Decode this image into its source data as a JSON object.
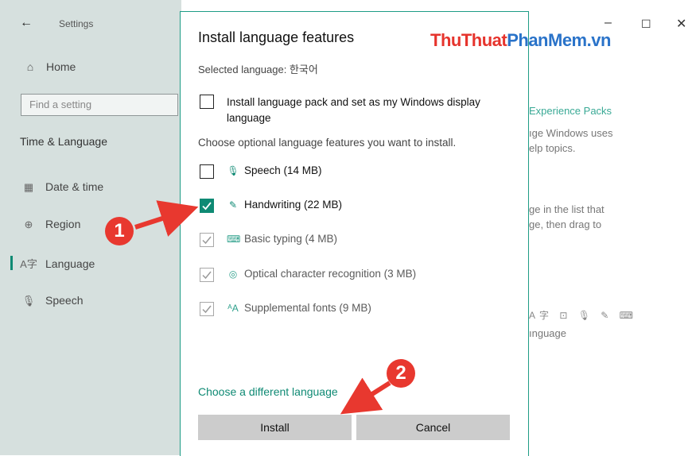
{
  "settings": {
    "back_icon": "back-arrow-icon",
    "title": "Settings",
    "home_label": "Home",
    "search_placeholder": "Find a setting",
    "section_label": "Time & Language",
    "items": [
      {
        "label": "Date & time",
        "icon": "calendar-clock-icon"
      },
      {
        "label": "Region",
        "icon": "globe-icon"
      },
      {
        "label": "Language",
        "icon": "language-icon"
      },
      {
        "label": "Speech",
        "icon": "microphone-icon"
      }
    ],
    "active_item": "Language"
  },
  "background_window": {
    "link": "Experience Packs",
    "lines": [
      "ıge Windows uses",
      "elp topics.",
      "ge in the list that",
      "ge, then drag to",
      "ınguage"
    ]
  },
  "dialog": {
    "title": "Install language features",
    "selected_language": "Selected language: 한국어",
    "language_pack_label": "Install language pack and set as my Windows display language",
    "language_pack_checked": false,
    "choose_text": "Choose optional language features you want to install.",
    "features": [
      {
        "label": "Speech (14 MB)",
        "icon": "microphone-icon",
        "checked": false,
        "disabled": false
      },
      {
        "label": "Handwriting (22 MB)",
        "icon": "pen-icon",
        "checked": true,
        "disabled": false
      },
      {
        "label": "Basic typing (4 MB)",
        "icon": "keyboard-icon",
        "checked": true,
        "disabled": true
      },
      {
        "label": "Optical character recognition (3 MB)",
        "icon": "ocr-icon",
        "checked": true,
        "disabled": true
      },
      {
        "label": "Supplemental fonts (9 MB)",
        "icon": "font-icon",
        "checked": true,
        "disabled": true
      }
    ],
    "different_language_link": "Choose a different language",
    "install_button": "Install",
    "cancel_button": "Cancel"
  },
  "watermark": {
    "part1": "ThuThuat",
    "part2": "PhanMem.vn"
  },
  "annotations": [
    {
      "label": "1"
    },
    {
      "label": "2"
    }
  ],
  "colors": {
    "accent": "#0f8a74",
    "annotation": "#e8382f",
    "sidebar_bg": "#d6e0de"
  }
}
